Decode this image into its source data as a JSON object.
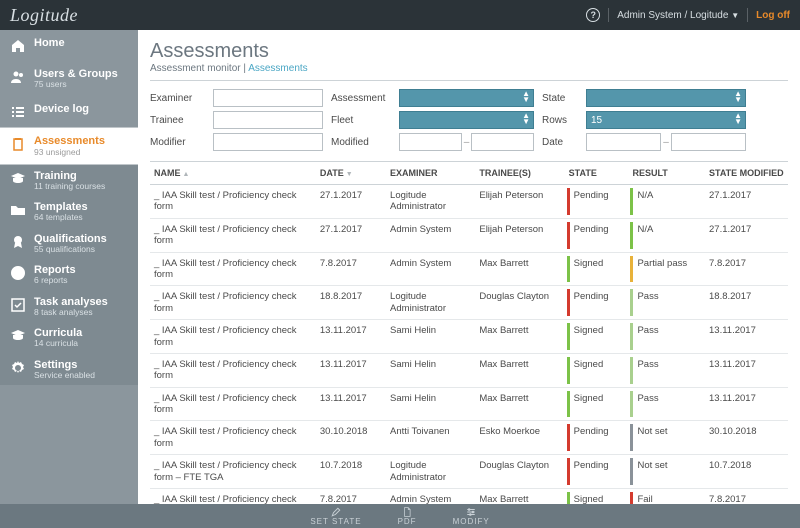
{
  "brand": "Logitude",
  "topbar": {
    "user": "Admin System / Logitude",
    "logoff": "Log off"
  },
  "sidebar": [
    {
      "key": "home",
      "title": "Home",
      "sub": "",
      "icon": "home"
    },
    {
      "key": "users",
      "title": "Users & Groups",
      "sub": "75 users",
      "icon": "users"
    },
    {
      "key": "devicelog",
      "title": "Device log",
      "sub": "",
      "icon": "list"
    },
    {
      "key": "assessments",
      "title": "Assessments",
      "sub": "93 unsigned",
      "icon": "clipboard",
      "active": true
    },
    {
      "key": "training",
      "title": "Training",
      "sub": "11 training courses",
      "icon": "grad"
    },
    {
      "key": "templates",
      "title": "Templates",
      "sub": "64 templates",
      "icon": "folder"
    },
    {
      "key": "qualifications",
      "title": "Qualifications",
      "sub": "55 qualifications",
      "icon": "award"
    },
    {
      "key": "reports",
      "title": "Reports",
      "sub": "6 reports",
      "icon": "pie"
    },
    {
      "key": "taskanalyses",
      "title": "Task analyses",
      "sub": "8 task analyses",
      "icon": "checkbox"
    },
    {
      "key": "curricula",
      "title": "Curricula",
      "sub": "14 curricula",
      "icon": "grad"
    },
    {
      "key": "settings",
      "title": "Settings",
      "sub": "Service enabled",
      "icon": "gear"
    }
  ],
  "page": {
    "title": "Assessments",
    "breadcrumb": {
      "parent": "Assessment monitor",
      "current": "Assessments"
    }
  },
  "filters": {
    "examiner": {
      "label": "Examiner",
      "value": ""
    },
    "assessment": {
      "label": "Assessment",
      "value": ""
    },
    "state": {
      "label": "State",
      "value": ""
    },
    "trainee": {
      "label": "Trainee",
      "value": ""
    },
    "fleet": {
      "label": "Fleet",
      "value": ""
    },
    "rows": {
      "label": "Rows",
      "value": "15"
    },
    "modifier": {
      "label": "Modifier",
      "value": ""
    },
    "modified": {
      "label": "Modified",
      "from": "",
      "to": ""
    },
    "date": {
      "label": "Date",
      "from": "",
      "to": ""
    }
  },
  "columns": {
    "name": "NAME",
    "date": "DATE",
    "examiner": "EXAMINER",
    "trainees": "TRAINEE(S)",
    "state": "STATE",
    "result": "RESULT",
    "state_modified": "STATE MODIFIED"
  },
  "state_colors": {
    "Pending": "#d43b2e",
    "Signed": "#7cc248"
  },
  "result_colors": {
    "N/A": "#7cc248",
    "Partial pass": "#e8b23a",
    "Pass": "#a9d08e",
    "Not set": "#8a9299",
    "Fail": "#d43b2e"
  },
  "rows": [
    {
      "name": "_ IAA Skill test / Proficiency check form",
      "date": "27.1.2017",
      "examiner": "Logitude Administrator",
      "trainee": "Elijah Peterson",
      "state": "Pending",
      "result": "N/A",
      "sm": "27.1.2017"
    },
    {
      "name": "_ IAA Skill test / Proficiency check form",
      "date": "27.1.2017",
      "examiner": "Admin System",
      "trainee": "Elijah Peterson",
      "state": "Pending",
      "result": "N/A",
      "sm": "27.1.2017"
    },
    {
      "name": "_ IAA Skill test / Proficiency check form",
      "date": "7.8.2017",
      "examiner": "Admin System",
      "trainee": "Max Barrett",
      "state": "Signed",
      "result": "Partial pass",
      "sm": "7.8.2017"
    },
    {
      "name": "_ IAA Skill test / Proficiency check form",
      "date": "18.8.2017",
      "examiner": "Logitude Administrator",
      "trainee": "Douglas Clayton",
      "state": "Pending",
      "result": "Pass",
      "sm": "18.8.2017"
    },
    {
      "name": "_ IAA Skill test / Proficiency check form",
      "date": "13.11.2017",
      "examiner": "Sami Helin",
      "trainee": "Max Barrett",
      "state": "Signed",
      "result": "Pass",
      "sm": "13.11.2017"
    },
    {
      "name": "_ IAA Skill test / Proficiency check form",
      "date": "13.11.2017",
      "examiner": "Sami Helin",
      "trainee": "Max Barrett",
      "state": "Signed",
      "result": "Pass",
      "sm": "13.11.2017"
    },
    {
      "name": "_ IAA Skill test / Proficiency check form",
      "date": "13.11.2017",
      "examiner": "Sami Helin",
      "trainee": "Max Barrett",
      "state": "Signed",
      "result": "Pass",
      "sm": "13.11.2017"
    },
    {
      "name": "_ IAA Skill test / Proficiency check form",
      "date": "30.10.2018",
      "examiner": "Antti Toivanen",
      "trainee": "Esko Moerkoe",
      "state": "Pending",
      "result": "Not set",
      "sm": "30.10.2018"
    },
    {
      "name": "_ IAA Skill test / Proficiency check form – FTE TGA",
      "date": "10.7.2018",
      "examiner": "Logitude Administrator",
      "trainee": "Douglas Clayton",
      "state": "Pending",
      "result": "Not set",
      "sm": "10.7.2018"
    },
    {
      "name": "_ IAA Skill test / Proficiency check form – TGA",
      "date": "7.8.2017",
      "examiner": "Admin System",
      "trainee": "Max Barrett",
      "state": "Signed",
      "result": "Fail",
      "sm": "7.8.2017"
    }
  ],
  "bottom": {
    "setstate": "SET STATE",
    "pdf": "PDF",
    "modify": "MODIFY"
  }
}
